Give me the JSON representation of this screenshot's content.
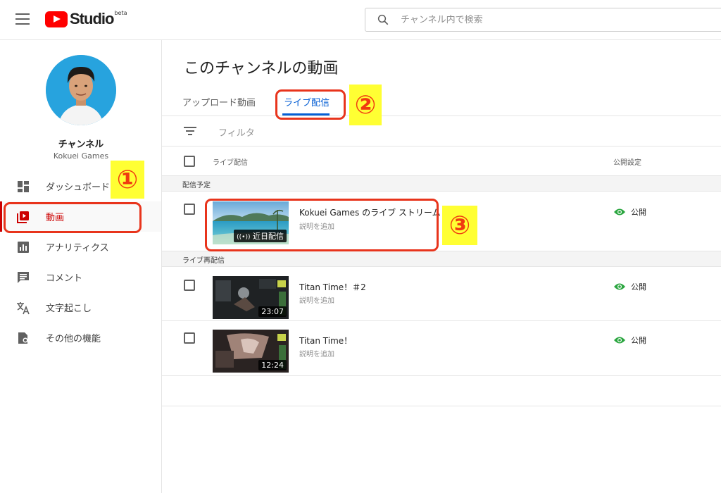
{
  "header": {
    "logo_text": "Studio",
    "logo_badge": "beta",
    "search_placeholder": "チャンネル内で検索"
  },
  "sidebar": {
    "channel_name": "チャンネル",
    "channel_sub": "Kokuei Games",
    "items": [
      {
        "label": "ダッシュボード",
        "icon": "dashboard-icon",
        "active": false
      },
      {
        "label": "動画",
        "icon": "video-library-icon",
        "active": true
      },
      {
        "label": "アナリティクス",
        "icon": "analytics-icon",
        "active": false
      },
      {
        "label": "コメント",
        "icon": "comment-icon",
        "active": false
      },
      {
        "label": "文字起こし",
        "icon": "translate-icon",
        "active": false
      },
      {
        "label": "その他の機能",
        "icon": "other-features-icon",
        "active": false
      }
    ]
  },
  "main": {
    "title": "このチャンネルの動画",
    "tabs": [
      {
        "label": "アップロード動画",
        "active": false
      },
      {
        "label": "ライブ配信",
        "active": true
      }
    ],
    "filter_label": "フィルタ",
    "table_headers": {
      "video": "ライブ配信",
      "visibility": "公開設定"
    },
    "sections": [
      {
        "label": "配信予定",
        "rows": [
          {
            "title": "Kokuei Games のライブ ストリーム",
            "desc": "説明を追加",
            "badge": "近日配信",
            "visibility": "公開"
          }
        ]
      },
      {
        "label": "ライブ再配信",
        "rows": [
          {
            "title": "Titan Time！＃2",
            "desc": "説明を追加",
            "badge": "23:07",
            "visibility": "公開"
          },
          {
            "title": "Titan Time！",
            "desc": "説明を追加",
            "badge": "12:24",
            "visibility": "公開"
          }
        ]
      }
    ]
  },
  "annotations": [
    "①",
    "②",
    "③"
  ],
  "colors": {
    "brand_red": "#ff0000",
    "active_red": "#cc0000",
    "tab_blue": "#065fd4",
    "public_green": "#2ba640",
    "annotation_red": "#e8341c",
    "annotation_yellow": "#ffff33"
  }
}
